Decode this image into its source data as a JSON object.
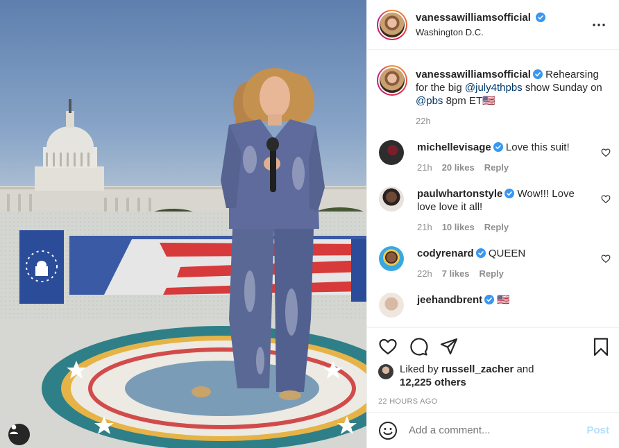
{
  "post": {
    "username": "vanessawilliamsofficial",
    "location": "Washington D.C.",
    "caption": {
      "username": "vanessawilliamsofficial",
      "text_1": " Rehearsing for the big ",
      "mention_1": "@july4thpbs",
      "text_2": " show Sunday on ",
      "mention_2": "@pbs",
      "text_3": " 8pm ET🇺🇸",
      "time": "22h"
    },
    "comments": [
      {
        "username": "michellevisage",
        "text": " Love this suit!",
        "time": "21h",
        "likes": "20 likes",
        "reply": "Reply",
        "avatar_color": "#3b3b3b"
      },
      {
        "username": "paulwhartonstyle",
        "text": " Wow!!! Love love love it all!",
        "time": "21h",
        "likes": "10 likes",
        "reply": "Reply",
        "avatar_color": "#6d5142"
      },
      {
        "username": "codyrenard",
        "text": " QUEEN",
        "time": "22h",
        "likes": "7 likes",
        "reply": "Reply",
        "avatar_color": "#3aa7e0"
      },
      {
        "username": "jeehandbrent",
        "text": " 🇺🇸",
        "time": "",
        "likes": "",
        "reply": "",
        "avatar_color": "#d8c2b3"
      }
    ],
    "liked_by": {
      "prefix": "Liked by ",
      "user": "russell_zacher",
      "middle": " and",
      "others": "12,225 others"
    },
    "timestamp": "22 HOURS AGO",
    "add_comment": {
      "placeholder": "Add a comment...",
      "post_label": "Post"
    }
  },
  "colors": {
    "verified": "#3897f0",
    "link": "#00376b",
    "muted": "#8e8e8e",
    "post_disabled": "#b2dffc"
  },
  "icons": [
    "more-icon",
    "verified-icon",
    "heart-icon",
    "comment-icon",
    "share-icon",
    "bookmark-icon",
    "emoji-icon",
    "user-tag-icon"
  ]
}
